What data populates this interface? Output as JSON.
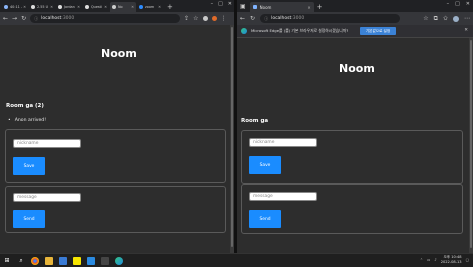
{
  "left_browser": {
    "tabs": [
      {
        "label": "40:11 -",
        "active": false
      },
      {
        "label": "2.55 U",
        "active": false
      },
      {
        "label": "Jordan",
        "active": false
      },
      {
        "label": "Questi",
        "active": false
      },
      {
        "label": "No",
        "active": true
      },
      {
        "label": "zoom",
        "active": false
      }
    ],
    "new_tab_label": "+",
    "url_host": "localhost",
    "url_port": ":3000"
  },
  "left_page": {
    "app_title": "Noom",
    "room_title": "Room ga (2)",
    "messages": [
      "Anon arrived!"
    ],
    "nickname_placeholder": "nickname",
    "save_label": "Save",
    "message_placeholder": "message",
    "send_label": "Send"
  },
  "right_browser": {
    "tab_label": "Noom",
    "new_tab_label": "+",
    "url_host": "localhost",
    "url_port": ":3000",
    "infobar_text": "Microsoft Edge를 (를) 기본 브라우저로 설정하시겠습니까?",
    "infobar_button": "기본값으로 설정"
  },
  "right_page": {
    "app_title": "Noom",
    "room_title": "Room ga",
    "nickname_placeholder": "nickname",
    "save_label": "Save",
    "message_placeholder": "message",
    "send_label": "Send"
  },
  "taskbar": {
    "time": "오후 10:48",
    "date": "2022-08-13"
  },
  "colors": {
    "accent_button": "#1a8cff",
    "page_background": "#2d2d2d"
  }
}
